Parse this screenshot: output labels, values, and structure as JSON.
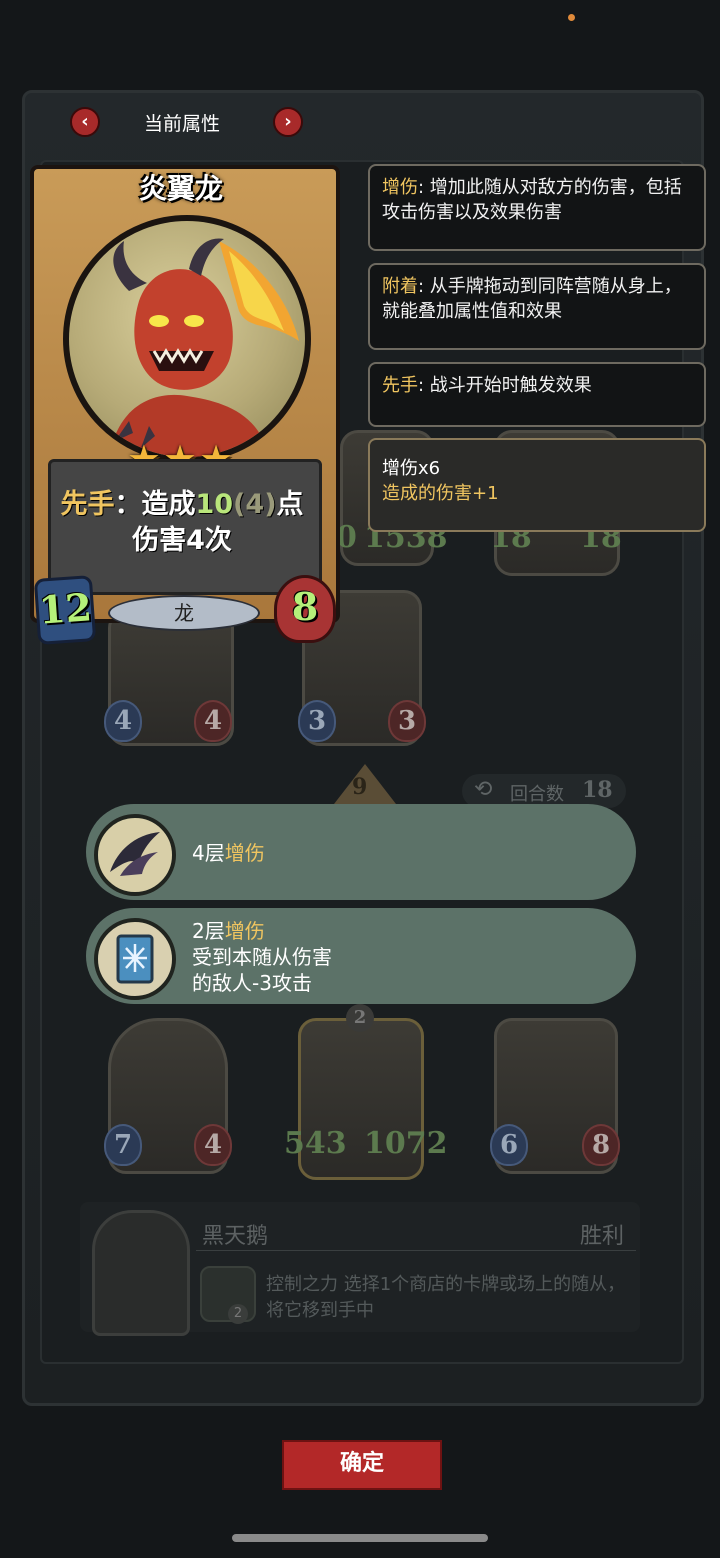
{
  "header": {
    "title": "当前属性",
    "prev": "‹",
    "next": "›"
  },
  "card": {
    "name": "炎翼龙",
    "stars": "★★★",
    "desc_keyword": "先手",
    "desc_colon": "：造成",
    "desc_num": "10",
    "desc_paren_open": "(",
    "desc_paren_num": "4",
    "desc_paren_close": ")",
    "desc_tail1": "点",
    "desc_line2": "伤害4次",
    "attack": "12",
    "health": "8",
    "tribe": "龙"
  },
  "tooltips": [
    {
      "keyword": "增伤",
      "text": ": 增加此随从对敌方的伤害，包括攻击伤害以及效果伤害"
    },
    {
      "keyword": "附着",
      "text": ": 从手牌拖动到同阵营随从身上，就能叠加属性值和效果"
    },
    {
      "keyword": "先手",
      "text": ": 战斗开始时触发效果"
    }
  ],
  "buff_summary": {
    "line1": "增伤x6",
    "line2": "造成的伤害+1"
  },
  "buffs": [
    {
      "count": "4层",
      "keyword": "增伤",
      "line2": "",
      "line3": ""
    },
    {
      "count": "2层",
      "keyword": "增伤",
      "line2": "受到本随从伤害",
      "line3": "的敌人-3攻击"
    }
  ],
  "board": {
    "round_label": "回合数",
    "round_value": "18",
    "tier_value": "9",
    "row1": [
      {
        "atk": "",
        "hp": "1538",
        "prefix": "0"
      },
      {
        "atk": "18",
        "hp": "18"
      }
    ],
    "row2": [
      {
        "atk": "4",
        "hp": "4"
      },
      {
        "atk": "3",
        "hp": "3"
      }
    ],
    "row3": [
      {
        "atk": "7",
        "hp": "4"
      },
      {
        "atk": "543",
        "hp": "1072",
        "badge": "2"
      },
      {
        "atk": "6",
        "hp": "8"
      }
    ],
    "opponent": {
      "name": "黑天鹅",
      "result": "胜利",
      "ability": "控制之力",
      "ability_desc": "选择1个商店的卡牌或场上的随从，将它移到手中",
      "ability_badge": "2"
    }
  },
  "confirm_label": "确定",
  "colors": {
    "accent_gold": "#f0c560",
    "confirm_red": "#b32828",
    "buff_bg": "#5c7268"
  }
}
